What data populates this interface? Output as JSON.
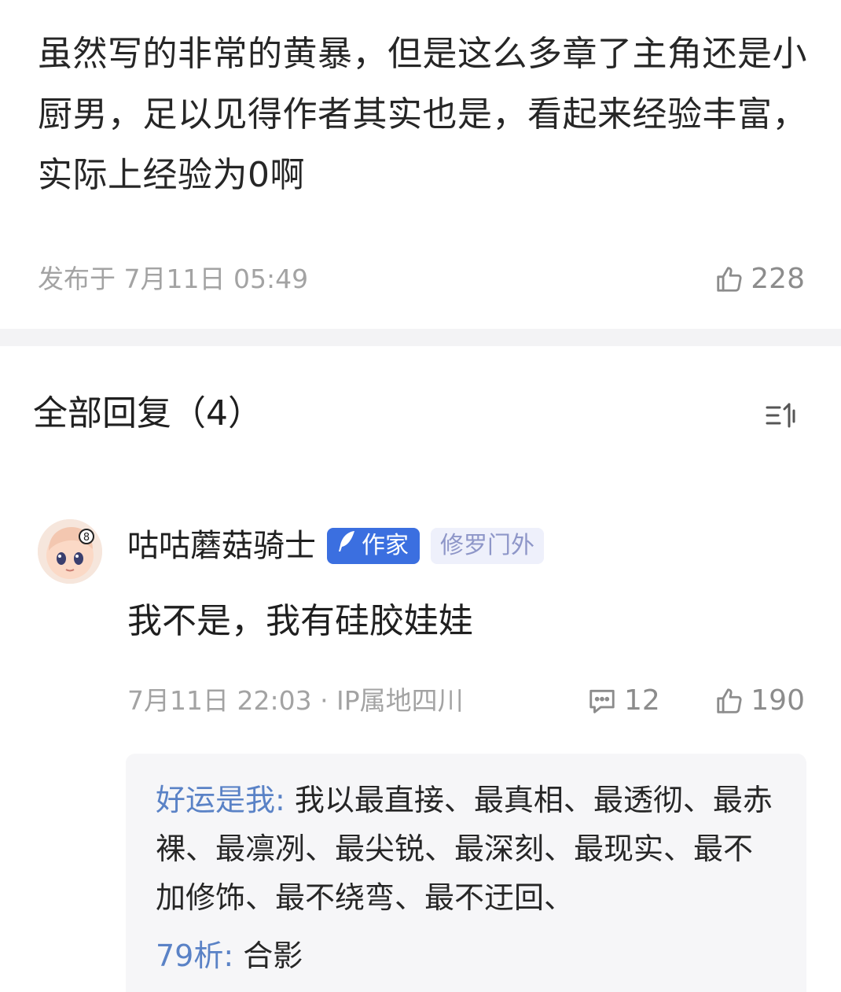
{
  "top_comment": {
    "text": "虽然写的非常的黄暴，但是这么多章了主角还是小厨男，足以见得作者其实也是，看起来经验丰富，实际上经验为0啊",
    "meta": "发布于 7月11日 05:49",
    "likes": "228"
  },
  "replies_header": {
    "title": "全部回复（4）"
  },
  "reply": {
    "username": "咕咕蘑菇骑士",
    "author_badge": "作家",
    "tag": "修罗门外",
    "text": "我不是，我有硅胶娃娃",
    "meta": "7月11日 22:03 · IP属地四川",
    "comment_count": "12",
    "likes": "190"
  },
  "sub_replies": [
    {
      "name": "好运是我:",
      "text": " 我以最直接、最真相、最透彻、最赤裸、最凛冽、最尖锐、最深刻、最现实、最不加修饰、最不绕弯、最不迂回、"
    },
    {
      "name": "79析:",
      "text": " 合影"
    }
  ],
  "icons": {
    "like": "thumbs-up-icon",
    "comment": "comment-bubble-icon",
    "sort": "sort-icon",
    "quill": "quill-icon"
  },
  "colors": {
    "author_badge": "#3b6fe0",
    "tag_text": "#8e96c8",
    "sub_name": "#5a82c6",
    "meta": "#a3a3a3"
  }
}
